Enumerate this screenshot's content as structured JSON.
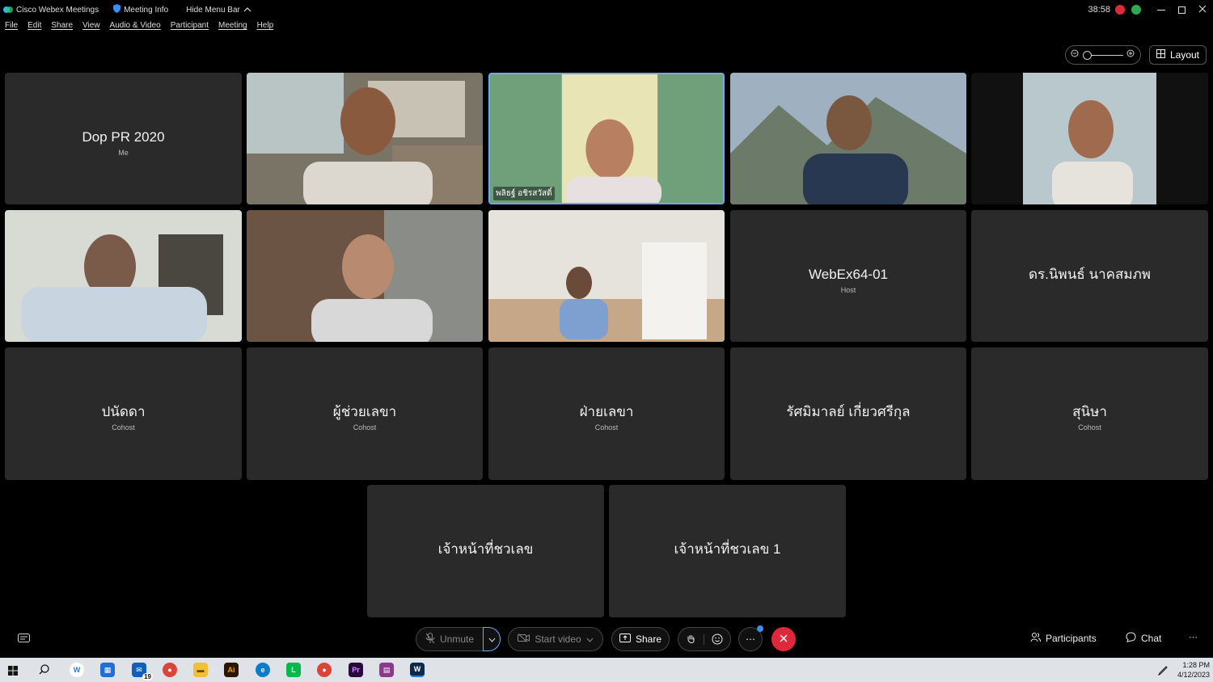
{
  "titlebar": {
    "app_name": "Cisco Webex Meetings",
    "meeting_info": "Meeting Info",
    "hide_menu": "Hide Menu Bar",
    "timer": "38:58"
  },
  "menu": [
    "File",
    "Edit",
    "Share",
    "View",
    "Audio & Video",
    "Participant",
    "Meeting",
    "Help"
  ],
  "layout_label": "Layout",
  "tiles": {
    "me": {
      "name": "Dop PR 2020",
      "role": "Me"
    },
    "speaker": {
      "caption": "พลิธฐ์ อชิรสวัสดิ์"
    },
    "webex": {
      "name": "WebEx64-01",
      "role": "Host"
    },
    "nipon": {
      "name": "ดร.นิพนธ์ นาคสมภพ",
      "role": ""
    },
    "panadda": {
      "name": "ปนัดดา",
      "role": "Cohost"
    },
    "assistant": {
      "name": "ผู้ช่วยเลขา",
      "role": "Cohost"
    },
    "secretary": {
      "name": "ฝ่ายเลขา",
      "role": "Cohost"
    },
    "ratsami": {
      "name": "รัศมิมาลย์ เกี่ยวศรีกุล",
      "role": ""
    },
    "sunisa": {
      "name": "สุนิษา",
      "role": "Cohost"
    },
    "staff": {
      "name": "เจ้าหน้าที่ชวเลข",
      "role": ""
    },
    "staff1": {
      "name": "เจ้าหน้าที่ชวเลข 1",
      "role": ""
    }
  },
  "controls": {
    "unmute": "Unmute",
    "start_video": "Start video",
    "share": "Share",
    "participants": "Participants",
    "chat": "Chat"
  },
  "taskbar": {
    "outlook_badge": "19",
    "time": "1:28 PM",
    "date": "4/12/2023"
  }
}
